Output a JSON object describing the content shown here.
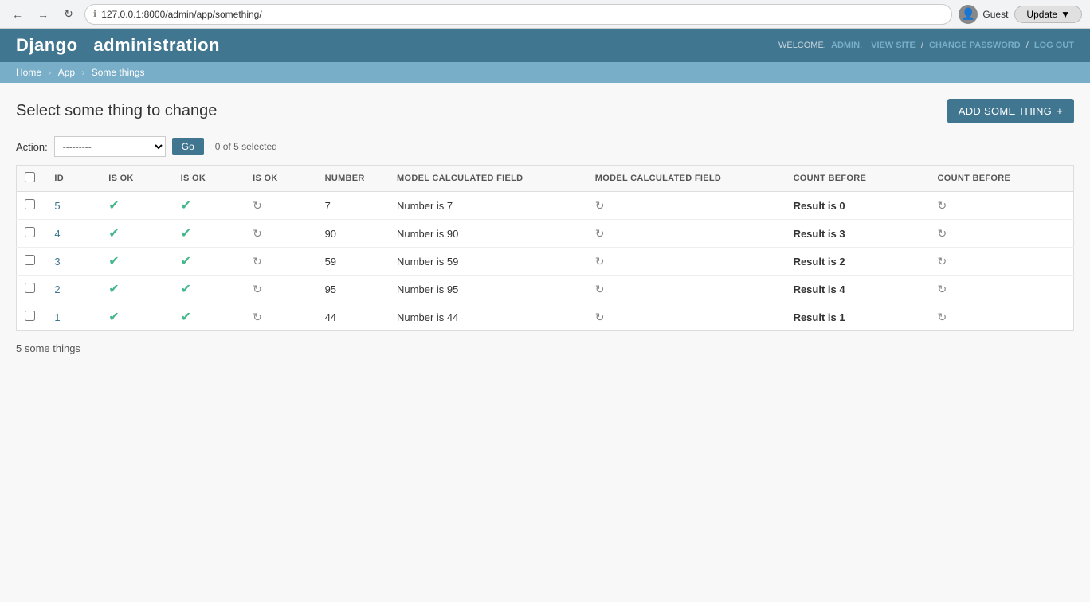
{
  "browser": {
    "url": "127.0.0.1:8000/admin/app/something/",
    "update_label": "Update",
    "guest_label": "Guest"
  },
  "header": {
    "title_prefix": "Django",
    "title_main": "administration",
    "welcome_text": "WELCOME,",
    "admin_label": "ADMIN",
    "view_site": "VIEW SITE",
    "change_password": "CHANGE PASSWORD",
    "log_out": "LOG OUT"
  },
  "breadcrumb": {
    "home": "Home",
    "app": "App",
    "current": "Some things"
  },
  "page": {
    "title": "Select some thing to change",
    "add_button": "ADD SOME THING"
  },
  "action": {
    "label": "Action:",
    "select_default": "---------",
    "go_label": "Go",
    "selection_count": "0 of 5 selected"
  },
  "table": {
    "columns": [
      {
        "key": "id",
        "label": "ID"
      },
      {
        "key": "isok1",
        "label": "IS OK"
      },
      {
        "key": "isok2",
        "label": "IS OK"
      },
      {
        "key": "isok3",
        "label": "IS OK"
      },
      {
        "key": "number",
        "label": "NUMBER"
      },
      {
        "key": "model_field1",
        "label": "MODEL CALCULATED FIELD"
      },
      {
        "key": "model_field2",
        "label": "MODEL CALCULATED FIELD"
      },
      {
        "key": "count_before1",
        "label": "COUNT BEFORE"
      },
      {
        "key": "count_before2",
        "label": "COUNT BEFORE"
      }
    ],
    "rows": [
      {
        "id": "5",
        "isok1": "check",
        "isok2": "check",
        "isok3": "refresh",
        "number": "7",
        "model_field1": "Number is 7",
        "model_field2": "refresh",
        "count_before1": "Result is 0",
        "count_before2": "refresh"
      },
      {
        "id": "4",
        "isok1": "check",
        "isok2": "check",
        "isok3": "refresh",
        "number": "90",
        "model_field1": "Number is 90",
        "model_field2": "refresh",
        "count_before1": "Result is 3",
        "count_before2": "refresh"
      },
      {
        "id": "3",
        "isok1": "check",
        "isok2": "check",
        "isok3": "refresh",
        "number": "59",
        "model_field1": "Number is 59",
        "model_field2": "refresh",
        "count_before1": "Result is 2",
        "count_before2": "refresh"
      },
      {
        "id": "2",
        "isok1": "check",
        "isok2": "check",
        "isok3": "refresh",
        "number": "95",
        "model_field1": "Number is 95",
        "model_field2": "refresh",
        "count_before1": "Result is 4",
        "count_before2": "refresh"
      },
      {
        "id": "1",
        "isok1": "check",
        "isok2": "check",
        "isok3": "refresh",
        "number": "44",
        "model_field1": "Number is 44",
        "model_field2": "refresh",
        "count_before1": "Result is 1",
        "count_before2": "refresh"
      }
    ],
    "footer": "5 some things"
  }
}
